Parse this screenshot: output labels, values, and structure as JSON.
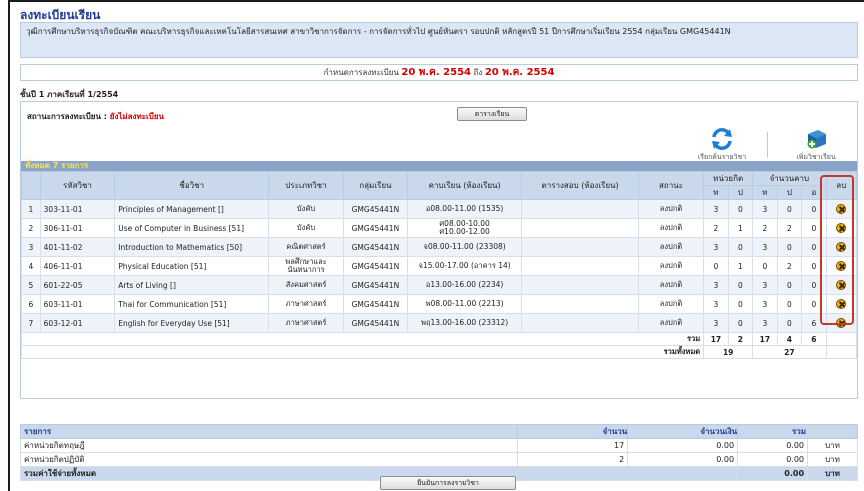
{
  "page_title": "ลงทะเบียนเรียน",
  "program_info": "วุฒิการศึกษาบริหารธุรกิจบัณฑิต คณะบริหารธุรกิจและเทคโนโลยีสารสนเทศ สาขาวิชาการจัดการ - การจัดการทั่วไป ศูนย์หันตรา รอบปกติ หลักสูตรปี 51 ปีการศึกษาเริ่มเรียน 2554 กลุ่มเรียน GMG45441N",
  "deadline": {
    "label": "กำหนดการลงทะเบียน",
    "start": "20 พ.ค. 2554",
    "to": "ถึง",
    "end": "20 พ.ค. 2554"
  },
  "year_semester": "ชั้นปี 1 ภาคเรียนที่ 1/2554",
  "registration_status": {
    "label": "สถานะการลงทะเบียน :",
    "value": "ยังไม่ลงทะเบียน"
  },
  "buttons": {
    "schedule": "ตารางเรียน",
    "search_courses": "เรียกค้นรายวิชา",
    "add_course": "เพิ่มวิชาเรียน",
    "print": "ยืนยันการลงรายวิชา"
  },
  "summary": "ทั้งหมด  7  รายการ",
  "table": {
    "headers": {
      "course_code": "รหัสวิชา",
      "course_name": "ชื่อวิชา",
      "course_type": "ประเภทวิชา",
      "group": "กลุ่มเรียน",
      "class_time": "คาบเรียน (ห้องเรียน)",
      "exam_schedule": "ตารางสอบ (ห้องเรียน)",
      "status": "สถานะ",
      "credits": "หน่วยกิต",
      "periods": "จำนวนคาบ",
      "drop": "ลบ",
      "t": "ท",
      "p": "ป",
      "o": "อ"
    },
    "rows": [
      {
        "no": "1",
        "code": "303-11-01",
        "name": "Principles of Management []",
        "type": "บังคับ",
        "group": "GMG45441N",
        "time": "อ08.00-11.00 (1535)",
        "exam": "",
        "status": "ลงปกติ",
        "cr_t": "3",
        "cr_p": "0",
        "h_t": "3",
        "h_p": "0",
        "h_o": "0"
      },
      {
        "no": "2",
        "code": "306-11-01",
        "name": "Use of Computer in Business [51]",
        "type": "บังคับ",
        "group": "GMG45441N",
        "time": "ศ08.00-10.00\nศ10.00-12.00",
        "exam": "",
        "status": "ลงปกติ",
        "cr_t": "2",
        "cr_p": "1",
        "h_t": "2",
        "h_p": "2",
        "h_o": "0"
      },
      {
        "no": "3",
        "code": "401-11-02",
        "name": "Introduction to Mathematics [50]",
        "type": "คณิตศาสตร์",
        "group": "GMG45441N",
        "time": "จ08.00-11.00 (23308)",
        "exam": "",
        "status": "ลงปกติ",
        "cr_t": "3",
        "cr_p": "0",
        "h_t": "3",
        "h_p": "0",
        "h_o": "0"
      },
      {
        "no": "4",
        "code": "406-11-01",
        "name": "Physical Education [51]",
        "type": "พลศึกษาและนันทนาการ",
        "group": "GMG45441N",
        "time": "จ15.00-17.00 (อาคาร 14)",
        "exam": "",
        "status": "ลงปกติ",
        "cr_t": "0",
        "cr_p": "1",
        "h_t": "0",
        "h_p": "2",
        "h_o": "0"
      },
      {
        "no": "5",
        "code": "601-22-05",
        "name": "Arts of Living []",
        "type": "สังคมศาสตร์",
        "group": "GMG45441N",
        "time": "อ13.00-16.00 (2234)",
        "exam": "",
        "status": "ลงปกติ",
        "cr_t": "3",
        "cr_p": "0",
        "h_t": "3",
        "h_p": "0",
        "h_o": "0"
      },
      {
        "no": "6",
        "code": "603-11-01",
        "name": "Thai for Communication [51]",
        "type": "ภาษาศาสตร์",
        "group": "GMG45441N",
        "time": "พ08.00-11.00 (2213)",
        "exam": "",
        "status": "ลงปกติ",
        "cr_t": "3",
        "cr_p": "0",
        "h_t": "3",
        "h_p": "0",
        "h_o": "0"
      },
      {
        "no": "7",
        "code": "603-12-01",
        "name": "English for Everyday Use [51]",
        "type": "ภาษาศาสตร์",
        "group": "GMG45441N",
        "time": "พฤ13.00-16.00 (23312)",
        "exam": "",
        "status": "ลงปกติ",
        "cr_t": "3",
        "cr_p": "0",
        "h_t": "3",
        "h_p": "0",
        "h_o": "6"
      }
    ],
    "totals": {
      "label": "รวม",
      "cr_t": "17",
      "cr_p": "2",
      "h_t": "17",
      "h_p": "4",
      "h_o": "6",
      "grand_label": "รวมทั้งหมด",
      "grand_credits": "19",
      "grand_hours": "27"
    }
  },
  "costs": {
    "headers": {
      "item": "รายการ",
      "qty": "จำนวน",
      "amount": "จำนวนเงิน",
      "total": "รวม"
    },
    "rows": [
      {
        "item": "ค่าหน่วยกิตทฤษฎี",
        "qty": "17",
        "amount": "0.00",
        "total": "0.00",
        "unit": "บาท"
      },
      {
        "item": "ค่าหน่วยกิตปฏิบัติ",
        "qty": "2",
        "amount": "0.00",
        "total": "0.00",
        "unit": "บาท"
      }
    ],
    "grand": {
      "label": "รวมค่าใช้จ่ายทั้งหมด",
      "total": "0.00",
      "unit": "บาท"
    }
  }
}
